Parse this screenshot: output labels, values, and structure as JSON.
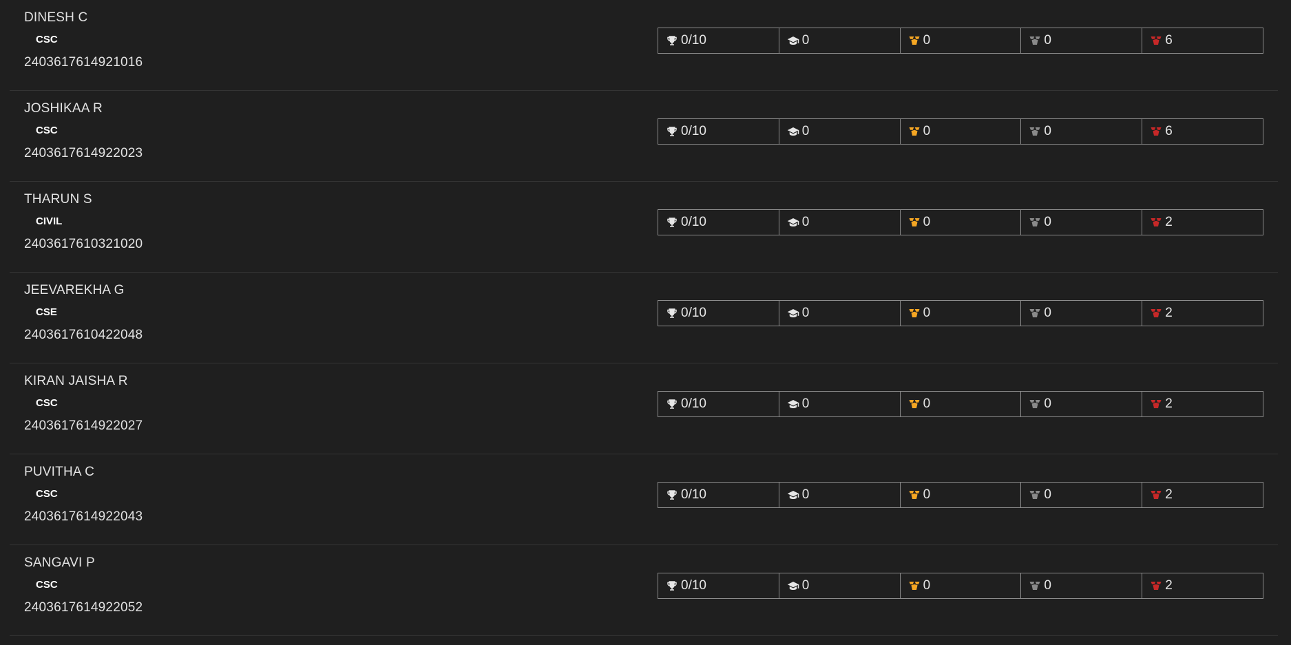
{
  "colors": {
    "background": "#1f1f1f",
    "trophy": "#e6e6e6",
    "cap": "#e6e6e6",
    "gold_badge": "#f5a623",
    "silver_badge": "#8a8a8a",
    "red_badge": "#c62828"
  },
  "icons": [
    "trophy-icon",
    "graduation-cap-icon",
    "gold-badge-icon",
    "silver-badge-icon",
    "red-badge-icon"
  ],
  "students": [
    {
      "name": "DINESH C",
      "dept": "CSC",
      "reg_no": "2403617614921016",
      "trophy": "0/10",
      "cap": "0",
      "gold": "0",
      "silver": "0",
      "red": "6"
    },
    {
      "name": "JOSHIKAA R",
      "dept": "CSC",
      "reg_no": "2403617614922023",
      "trophy": "0/10",
      "cap": "0",
      "gold": "0",
      "silver": "0",
      "red": "6"
    },
    {
      "name": "THARUN S",
      "dept": "CIVIL",
      "reg_no": "2403617610321020",
      "trophy": "0/10",
      "cap": "0",
      "gold": "0",
      "silver": "0",
      "red": "2"
    },
    {
      "name": "JEEVAREKHA G",
      "dept": "CSE",
      "reg_no": "2403617610422048",
      "trophy": "0/10",
      "cap": "0",
      "gold": "0",
      "silver": "0",
      "red": "2"
    },
    {
      "name": "KIRAN JAISHA R",
      "dept": "CSC",
      "reg_no": "2403617614922027",
      "trophy": "0/10",
      "cap": "0",
      "gold": "0",
      "silver": "0",
      "red": "2"
    },
    {
      "name": "PUVITHA C",
      "dept": "CSC",
      "reg_no": "2403617614922043",
      "trophy": "0/10",
      "cap": "0",
      "gold": "0",
      "silver": "0",
      "red": "2"
    },
    {
      "name": "SANGAVI P",
      "dept": "CSC",
      "reg_no": "2403617614922052",
      "trophy": "0/10",
      "cap": "0",
      "gold": "0",
      "silver": "0",
      "red": "2"
    }
  ]
}
